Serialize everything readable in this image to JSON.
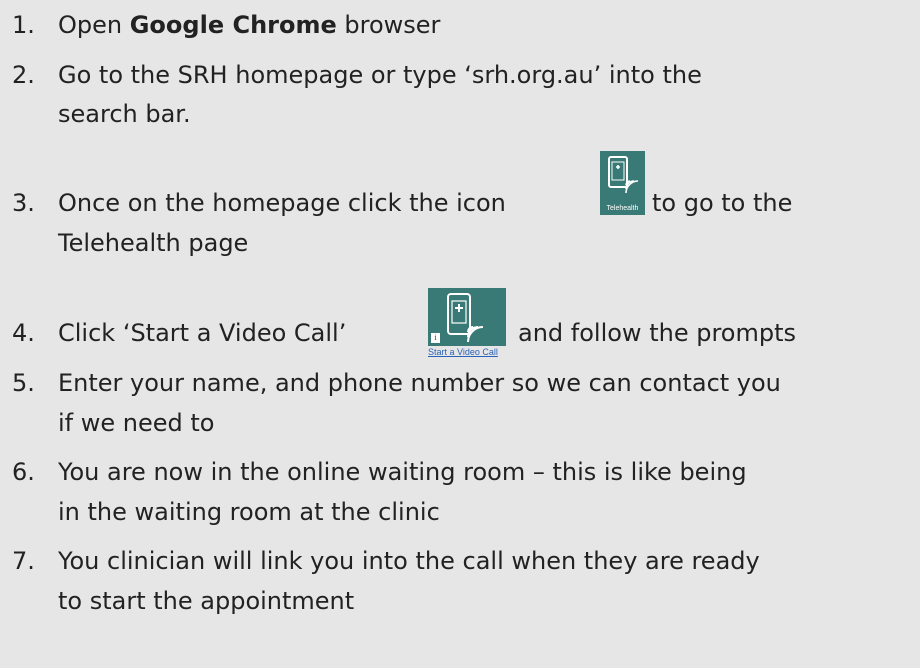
{
  "steps": [
    {
      "number": "1.",
      "pre": "Open ",
      "bold": "Google Chrome",
      "post": " browser"
    },
    {
      "number": "2.",
      "line1": "Go to the SRH homepage or type ‘srh.org.au’ into the",
      "line2": "search bar."
    },
    {
      "number": "3.",
      "pre": "Once on the homepage click the icon",
      "post": "to go to the",
      "line2": "Telehealth page"
    },
    {
      "number": "4.",
      "pre": "Click ‘Start a Video Call’",
      "post": "and follow the prompts"
    },
    {
      "number": "5.",
      "line1": "Enter your name, and phone number so we can contact you",
      "line2": "if we need to"
    },
    {
      "number": "6.",
      "line1": "You are now in the online waiting room – this is like being",
      "line2": "in the waiting room at the clinic"
    },
    {
      "number": "7.",
      "line1": "You clinician will link you into the call when they are ready",
      "line2": "to start the appointment"
    }
  ],
  "telehealth_icon": {
    "icon": "telehealth-phone-icon",
    "label": "Telehealth"
  },
  "video_call_icon": {
    "icon": "video-call-phone-icon",
    "link_label": "Start a Video Call"
  },
  "colors": {
    "background": "#e6e6e6",
    "icon_bg": "#3a7a76",
    "link": "#2a62b8"
  }
}
